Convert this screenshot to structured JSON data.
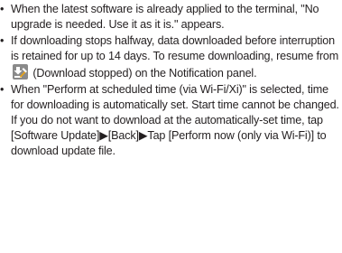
{
  "bullet_symbol": "•",
  "notes": [
    {
      "text": "When the latest software is already applied to the terminal, \"No upgrade is needed. Use it as it is.\" appears."
    },
    {
      "text_before_icon": "If downloading stops halfway, data downloaded before interruption is retained for up to 14 days. To resume downloading, resume from ",
      "icon": "download-stopped-icon",
      "text_after_icon": " (Download stopped) on the Notification panel."
    },
    {
      "text": "When \"Perform at scheduled time (via Wi-Fi/Xi)\" is selected, time for downloading is automatically set. Start time cannot be changed. If you do not want to download at the automatically-set time, tap [Software Update]▶[Back]▶Tap [Perform now (only via Wi-Fi)] to download update file."
    }
  ],
  "colors": {
    "text": "#231f20",
    "icon_background": "#8a8a8a",
    "icon_accent": "#e8a317"
  }
}
